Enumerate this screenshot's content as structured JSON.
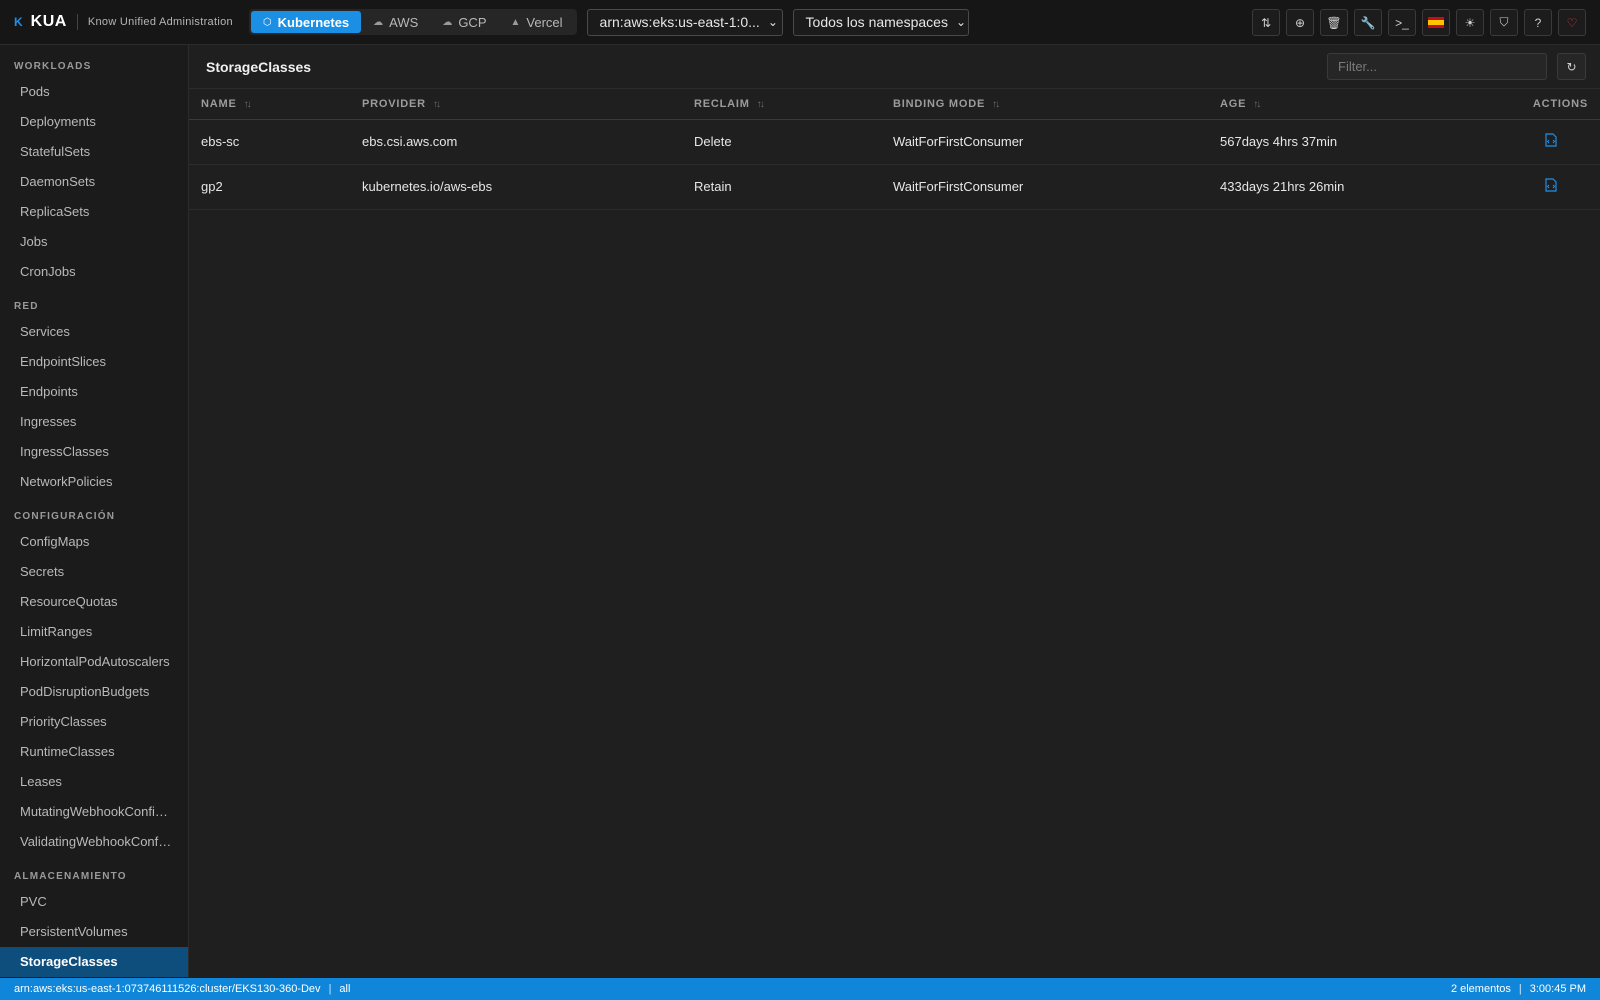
{
  "app": {
    "logo": "K",
    "name": "KUA",
    "tagline": "Know Unified Administration"
  },
  "providers": [
    {
      "label": "Kubernetes",
      "icon": "cube-icon",
      "active": true
    },
    {
      "label": "AWS",
      "icon": "cloud-icon",
      "active": false
    },
    {
      "label": "GCP",
      "icon": "cloud-upload-icon",
      "active": false
    },
    {
      "label": "Vercel",
      "icon": "triangle-icon",
      "active": false
    }
  ],
  "cluster_select": {
    "value": "arn:aws:eks:us-east-1:0..."
  },
  "namespace_select": {
    "value": "Todos los namespaces"
  },
  "toolbar": [
    {
      "name": "port-forward-icon"
    },
    {
      "name": "add-circle-icon"
    },
    {
      "name": "trash-icon"
    },
    {
      "name": "wrench-icon"
    },
    {
      "name": "terminal-icon"
    },
    {
      "name": "spain-flag-icon"
    },
    {
      "name": "sun-icon"
    },
    {
      "name": "shield-icon"
    },
    {
      "name": "help-icon"
    },
    {
      "name": "heart-icon"
    }
  ],
  "sidebar": {
    "sections": [
      {
        "title": "WORKLOADS",
        "items": [
          "Pods",
          "Deployments",
          "StatefulSets",
          "DaemonSets",
          "ReplicaSets",
          "Jobs",
          "CronJobs"
        ]
      },
      {
        "title": "RED",
        "items": [
          "Services",
          "EndpointSlices",
          "Endpoints",
          "Ingresses",
          "IngressClasses",
          "NetworkPolicies"
        ]
      },
      {
        "title": "CONFIGURACIÓN",
        "items": [
          "ConfigMaps",
          "Secrets",
          "ResourceQuotas",
          "LimitRanges",
          "HorizontalPodAutoscalers",
          "PodDisruptionBudgets",
          "PriorityClasses",
          "RuntimeClasses",
          "Leases",
          "MutatingWebhookConfigurations",
          "ValidatingWebhookConfigurations"
        ]
      },
      {
        "title": "ALMACENAMIENTO",
        "items": [
          "PVC",
          "PersistentVolumes",
          "StorageClasses"
        ]
      }
    ],
    "active_item": "StorageClasses"
  },
  "main": {
    "title": "StorageClasses",
    "filter_placeholder": "Filter...",
    "columns": [
      "NAME",
      "PROVIDER",
      "RECLAIM",
      "BINDING MODE",
      "AGE",
      "ACTIONS"
    ],
    "rows": [
      {
        "name": "ebs-sc",
        "provisioner": "ebs.csi.aws.com",
        "reclaim": "Delete",
        "binding_mode": "WaitForFirstConsumer",
        "age": "567days 4hrs 37min"
      },
      {
        "name": "gp2",
        "provisioner": "kubernetes.io/aws-ebs",
        "reclaim": "Retain",
        "binding_mode": "WaitForFirstConsumer",
        "age": "433days 21hrs 26min"
      }
    ]
  },
  "status": {
    "context": "arn:aws:eks:us-east-1:073746111526:cluster/EKS130-360-Dev",
    "namespace": "all",
    "count": "2 elementos",
    "time": "3:00:45 PM"
  },
  "colors": {
    "accent": "#1a8fe3",
    "sidebar_active": "#0e4e7d",
    "status_bar": "#0f86d9",
    "heart": "#e0404a"
  }
}
